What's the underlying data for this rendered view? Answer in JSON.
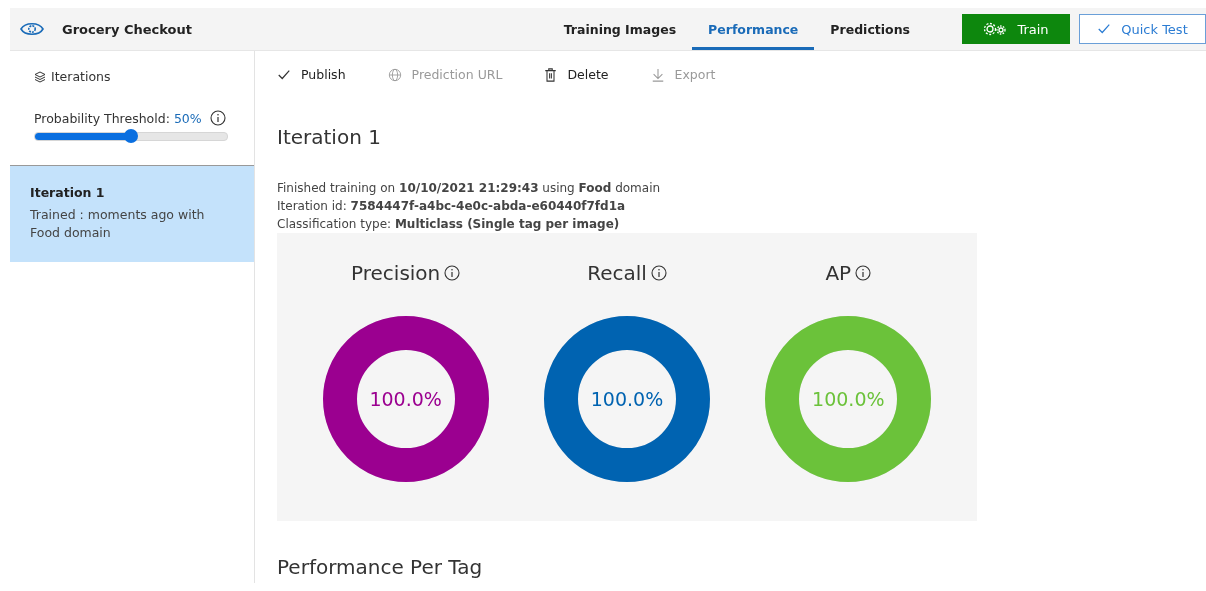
{
  "header": {
    "title": "Grocery Checkout",
    "tabs": [
      {
        "label": "Training Images",
        "selected": false
      },
      {
        "label": "Performance",
        "selected": true
      },
      {
        "label": "Predictions",
        "selected": false
      }
    ],
    "buttons": [
      {
        "kind": "train",
        "label": "Train"
      },
      {
        "kind": "quicktest",
        "label": "Quick Test"
      }
    ]
  },
  "sidebar": {
    "heading": "Iterations",
    "threshold_label": "Probability Threshold:",
    "threshold_value": "50%",
    "threshold": {
      "level": 0.5
    },
    "items": [
      {
        "title": "Iteration 1",
        "subtitle": "Trained : moments ago with Food domain",
        "selected": true
      }
    ]
  },
  "toolbar": [
    {
      "kind": "check",
      "label": "Publish",
      "disabled": false
    },
    {
      "kind": "globe",
      "label": "Prediction URL",
      "disabled": true
    },
    {
      "kind": "trash",
      "label": "Delete",
      "disabled": false
    },
    {
      "kind": "download",
      "label": "Export",
      "disabled": true
    }
  ],
  "iteration": {
    "title": "Iteration 1",
    "details": [
      "Finished training on **10/10/2021 21:29:43** using **Food** domain",
      "Iteration id: **7584447f-a4bc-4e0c-abda-e60440f7fd1a**",
      "Classification type: **Multiclass (Single tag per image)**"
    ],
    "metrics": [
      {
        "label": "Precision",
        "value": "100.0%",
        "level": 1,
        "color": "#9b0090"
      },
      {
        "label": "Recall",
        "value": "100.0%",
        "level": 1,
        "color": "#0063b1"
      },
      {
        "label": "AP",
        "value": "100.0%",
        "level": 1,
        "color": "#6bc23a"
      }
    ]
  },
  "section_title": "Performance Per Tag"
}
